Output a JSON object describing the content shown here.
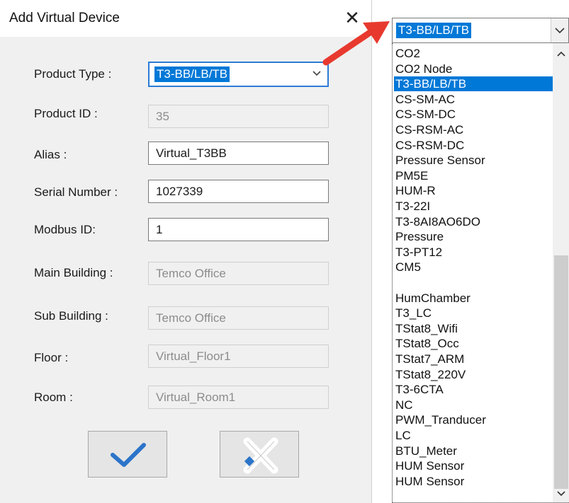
{
  "dialog": {
    "title": "Add Virtual Device",
    "close_glyph": "✕",
    "fields": {
      "product_type": {
        "label": "Product Type :",
        "value": "T3-BB/LB/TB"
      },
      "product_id": {
        "label": "Product ID :",
        "value": "35"
      },
      "alias": {
        "label": "Alias :",
        "value": "Virtual_T3BB"
      },
      "serial_number": {
        "label": "Serial Number :",
        "value": "1027339"
      },
      "modbus_id": {
        "label": "Modbus ID:",
        "value": "1"
      },
      "main_building": {
        "label": "Main Building :",
        "value": "Temco Office"
      },
      "sub_building": {
        "label": "Sub Building :",
        "value": "Temco Office"
      },
      "floor": {
        "label": "Floor :",
        "value": "Virtual_Floor1"
      },
      "room": {
        "label": "Room :",
        "value": "Virtual_Room1"
      }
    },
    "buttons": {
      "ok_icon": "checkmark-icon",
      "cancel_icon": "cancel-x-icon"
    }
  },
  "dropdown": {
    "selected": "T3-BB/LB/TB",
    "items": [
      "CO2",
      "CO2 Node",
      "T3-BB/LB/TB",
      "CS-SM-AC",
      "CS-SM-DC",
      "CS-RSM-AC",
      "CS-RSM-DC",
      "Pressure Sensor",
      "PM5E",
      "HUM-R",
      "T3-22I",
      "T3-8AI8AO6DO",
      "Pressure",
      "T3-PT12",
      "CM5",
      "",
      "HumChamber",
      "T3_LC",
      "TStat8_Wifi",
      "TStat8_Occ",
      "TStat7_ARM",
      "TStat8_220V",
      "T3-6CTA",
      "NC",
      "PWM_Tranducer",
      "LC",
      "BTU_Meter",
      "HUM Sensor",
      "HUM Sensor"
    ]
  },
  "colors": {
    "accent": "#0078d7",
    "annotation_arrow": "#e8392f",
    "ok_check": "#2b74c9"
  }
}
